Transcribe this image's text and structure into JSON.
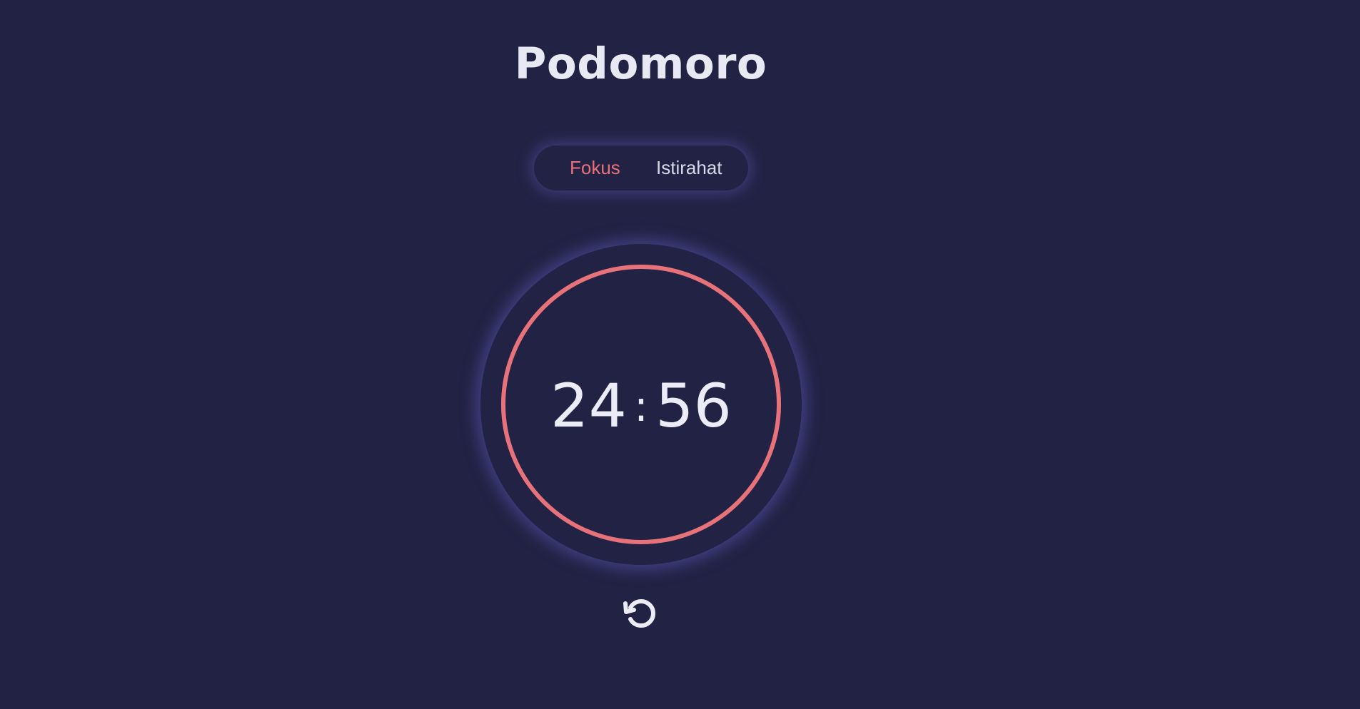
{
  "app": {
    "title": "Podomoro"
  },
  "modes": {
    "items": [
      "Fokus",
      "Istirahat"
    ],
    "selected": "Fokus"
  },
  "timer": {
    "minutes": "24",
    "separator": ":",
    "seconds": "56",
    "progress_ring_color": "#e8727a"
  },
  "controls": {
    "reset_icon": "reset-icon"
  },
  "colors": {
    "background": "#222244",
    "accent": "#e8727a",
    "text": "#ececf6",
    "glow": "#6464c8"
  }
}
